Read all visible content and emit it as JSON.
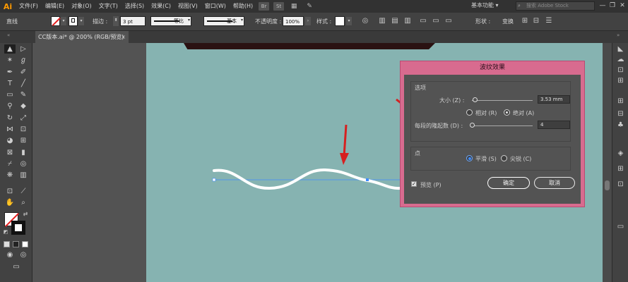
{
  "app": {
    "logo": "Ai",
    "menu": [
      "文件(F)",
      "编辑(E)",
      "对象(O)",
      "文字(T)",
      "选择(S)",
      "效果(C)",
      "视图(V)",
      "窗口(W)",
      "帮助(H)"
    ],
    "badges": [
      "Br",
      "St"
    ],
    "workspace": "基本功能",
    "search_placeholder": "搜索 Adobe Stock",
    "window_controls": [
      "—",
      "❐",
      "✕"
    ]
  },
  "control_bar": {
    "object_type": "直线",
    "stroke_label": "描边 :",
    "stroke_weight": "3 pt",
    "profile_label": "等比",
    "brush_label": "基本",
    "opacity_label": "不透明度 :",
    "opacity_value": "100%",
    "style_label": "样式 :",
    "shape_label": "形状 :",
    "transform_label": "变换"
  },
  "document": {
    "tab_title": "CC版本.ai* @ 200% (RGB/预览)",
    "close": "×"
  },
  "dialog": {
    "title": "波纹效果",
    "options_group": "选项",
    "size_label": "大小 (Z) :",
    "size_value": "3.53 mm",
    "relative_label": "相对 (R)",
    "absolute_label": "绝对 (A)",
    "ridges_label": "每段的隆起数 (D) :",
    "ridges_value": "4",
    "point_group": "点",
    "smooth_label": "平滑 (S)",
    "corner_label": "尖锐 (C)",
    "preview_label": "预览 (P)",
    "preview_checked": true,
    "ok_label": "确定",
    "cancel_label": "取消",
    "selected_point_type": "smooth",
    "selected_size_mode": "absolute"
  },
  "colors": {
    "artboard": "#86b3b1",
    "dialog_frame": "#d86b8f",
    "arrow": "#d62020",
    "wave": "#ffffff"
  },
  "icons": {
    "search": "search-icon",
    "arrow": "red-arrow-annotation"
  }
}
